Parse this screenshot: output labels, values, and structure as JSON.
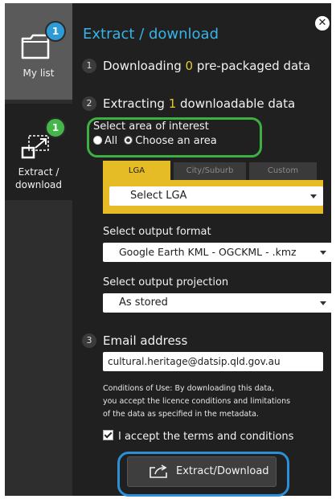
{
  "sidebar": {
    "mylist": {
      "label": "My list",
      "badge": "1"
    },
    "extract": {
      "label_line1": "Extract /",
      "label_line2": "download",
      "badge": "1"
    }
  },
  "panel": {
    "title": "Extract / download",
    "close_glyph": "✕",
    "step1": {
      "num": "1",
      "prefix": "Downloading ",
      "count": "0",
      "suffix": " pre-packaged data"
    },
    "step2": {
      "num": "2",
      "prefix": "Extracting ",
      "count": "1",
      "suffix": " downloadable data"
    },
    "step3": {
      "num": "3",
      "label": "Email address"
    }
  },
  "area": {
    "title": "Select area of interest",
    "options": [
      "All",
      "Choose an area"
    ],
    "selected": "Choose an area"
  },
  "tabs": [
    {
      "label": "LGA",
      "active": true
    },
    {
      "label": "City/Suburb",
      "active": false
    },
    {
      "label": "Custom",
      "active": false
    }
  ],
  "lga_select": {
    "value": "Select LGA"
  },
  "format": {
    "label": "Select output format",
    "value": "Google Earth KML - OGCKML - .kmz"
  },
  "projection": {
    "label": "Select output projection",
    "value": "As stored"
  },
  "email": {
    "value": "cultural.heritage@datsip.qld.gov.au"
  },
  "conditions": {
    "line1": "Conditions of Use: By downloading this data,",
    "line2": "you accept the licence conditions and limitations",
    "line3": "of the data as specified in the metadata."
  },
  "accept": {
    "label": "I accept the terms and conditions",
    "checked": true
  },
  "action": {
    "label": "Extract/Download"
  },
  "colors": {
    "accent_blue": "#38b3e6",
    "accent_yellow": "#e6bc26",
    "highlight_green": "#3cb043",
    "highlight_blue": "#2c8fd8"
  }
}
